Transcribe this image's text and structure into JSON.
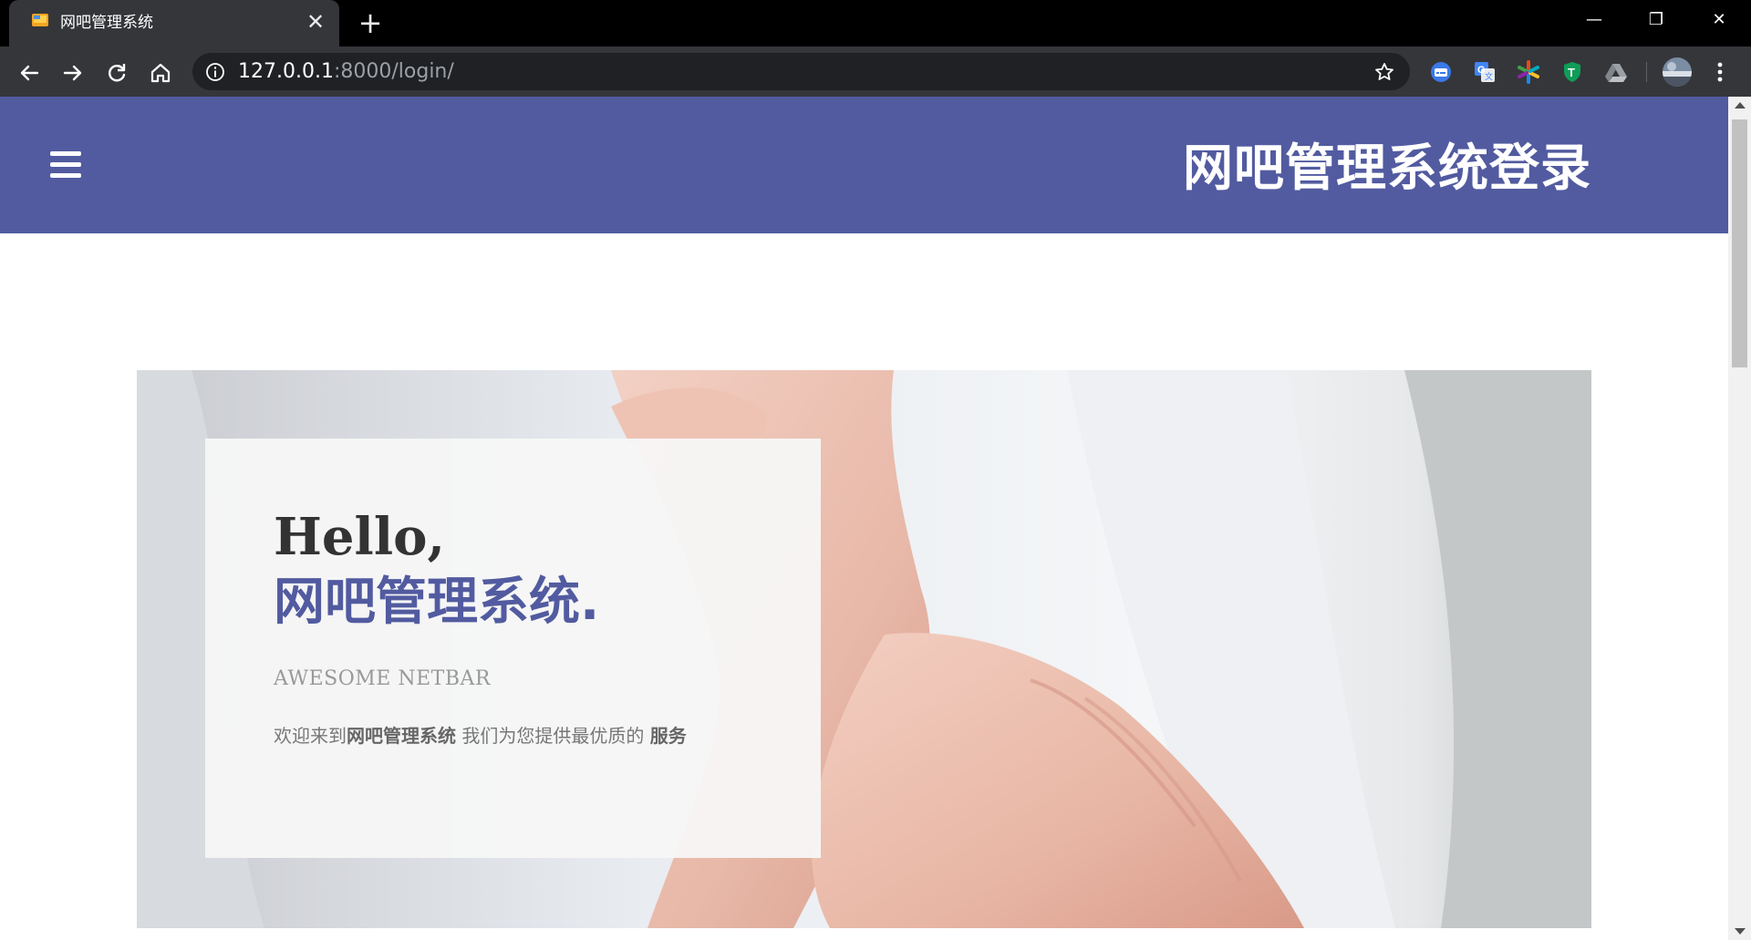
{
  "browser": {
    "tab": {
      "title": "网吧管理系统",
      "close_glyph": "✕"
    },
    "new_tab_glyph": "+",
    "window_controls": {
      "minimize": "—",
      "restore": "❐",
      "close": "✕"
    },
    "omnibox": {
      "host": "127.0.0.1",
      "rest": ":8000/login/"
    },
    "extensions": [
      "captions-icon",
      "google-translate-icon",
      "asterisk-extension-icon",
      "shield-t-icon",
      "drive-icon"
    ],
    "colors": {
      "toolbar": "#35363a",
      "tabstrip": "#000000",
      "omnibox": "#202124"
    }
  },
  "page": {
    "header": {
      "title": "网吧管理系统登录",
      "background": "#525ba0"
    },
    "hero": {
      "hello": "Hello,",
      "brand": "网吧管理系统.",
      "subtitle": "AWESOME NETBAR",
      "welcome": {
        "part1": "欢迎来到",
        "bold1": "网吧管理系统",
        "part2": " 我们为您提供最优质的 ",
        "bold2": "服务"
      },
      "accent": "#525ba0"
    }
  }
}
